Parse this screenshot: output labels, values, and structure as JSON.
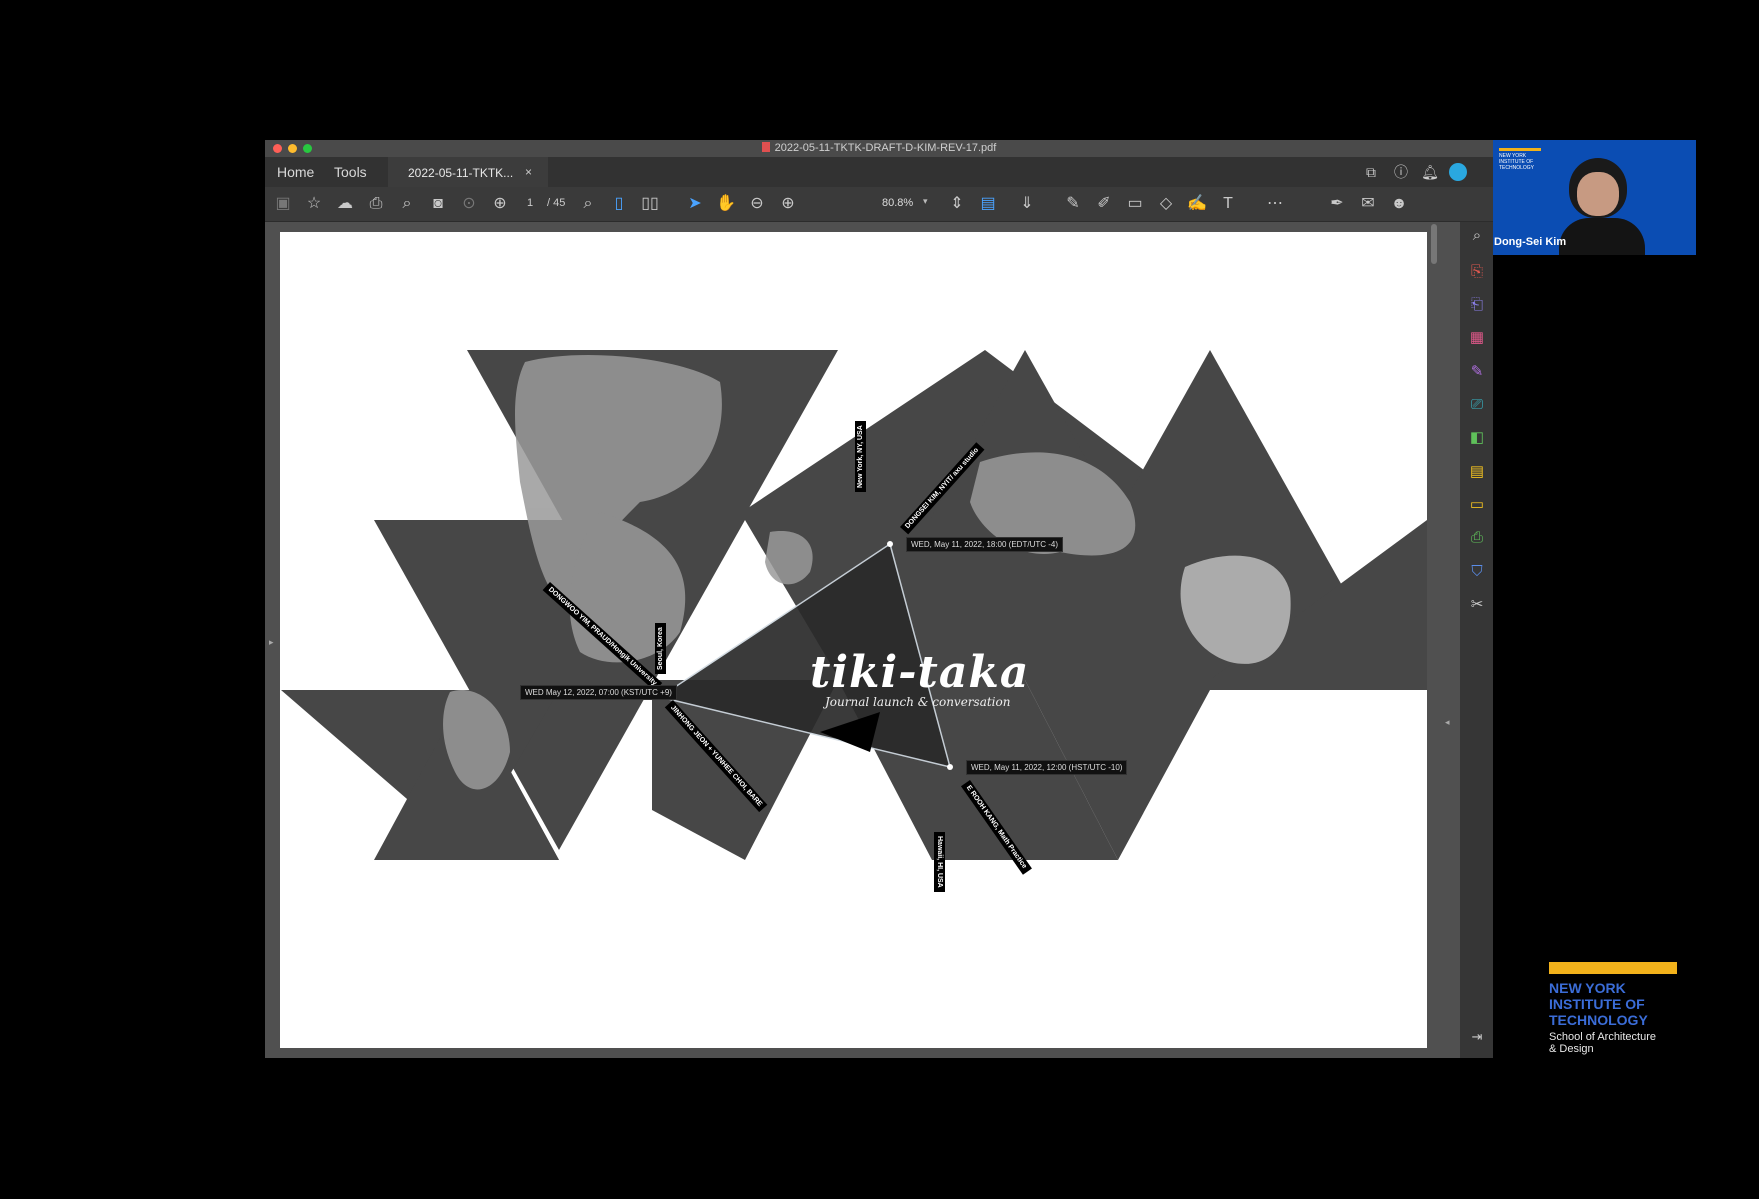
{
  "window": {
    "document_title": "2022-05-11-TKTK-DRAFT-D-KIM-REV-17.pdf"
  },
  "tabs": {
    "home": "Home",
    "tools": "Tools",
    "document_tab": "2022-05-11-TKTK...",
    "close_glyph": "×"
  },
  "toolbar": {
    "current_page": "1",
    "total_pages": "/ 45",
    "zoom": "80.8%"
  },
  "map": {
    "title": "tiki-taka",
    "subtitle": "Journal launch & conversation",
    "labels": {
      "ny_location": "New York, NY, USA",
      "ny_person": "DONGSEI KIM, NYIT/ axu studio",
      "ny_time": "WED, May 11, 2022, 18:00 (EDT/UTC -4)",
      "seoul_person": "DONGWOO YIM, PRAUD/Hongik University",
      "seoul_location": "Seoul, Korea",
      "seoul_time": "WED May 12, 2022, 07:00 (KST/UTC +9)",
      "seoul_person2": "JINHONG JEON + YUNHEE CHOI, BARE",
      "hawaii_time": "WED, May 11, 2022, 12:00 (HST/UTC -10)",
      "hawaii_location": "Hawaii, HI, USA",
      "hawaii_person": "E ROOH KANG, Math Practice"
    }
  },
  "video": {
    "participant_name": "Dong-Sei Kim",
    "badge_text": "NEW YORK INSTITUTE OF TECHNOLOGY"
  },
  "branding": {
    "institution": "NEW YORK INSTITUTE OF TECHNOLOGY",
    "school_line1": "School of Architecture",
    "school_line2": "& Design"
  },
  "colors": {
    "accent_blue": "#4aa3ff",
    "nyit_blue": "#3b6dd8",
    "nyit_gold": "#f2b21b",
    "video_bg": "#0b4db3"
  }
}
